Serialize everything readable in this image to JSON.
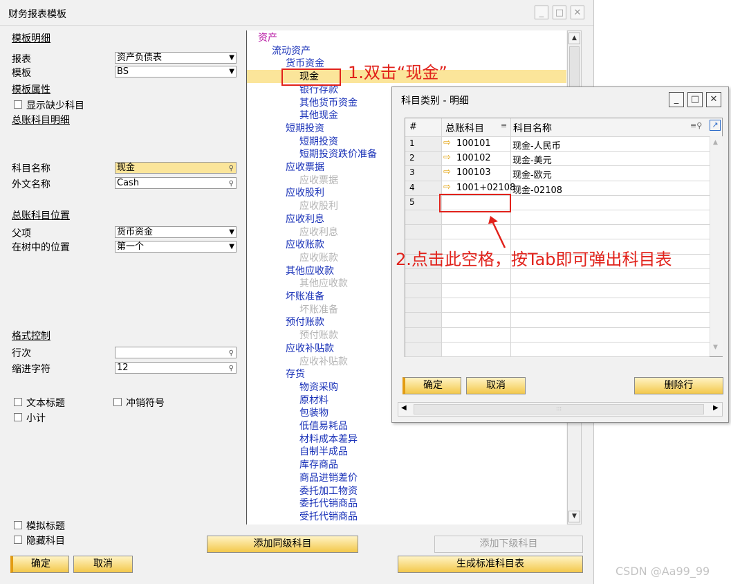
{
  "window": {
    "title": "财务报表模板",
    "controls": [
      "_",
      "□",
      "✕"
    ]
  },
  "left": {
    "template_detail": "模板明细",
    "report_label": "报表",
    "report_value": "资产负债表",
    "template_label": "模板",
    "template_value": "BS",
    "template_props": "模板属性",
    "show_missing": "显示缺少科目",
    "gl_detail": "总账科目明细",
    "acct_name_label": "科目名称",
    "acct_name_value": "现金",
    "foreign_name_label": "外文名称",
    "foreign_name_value": "Cash",
    "gl_position": "总账科目位置",
    "parent_label": "父项",
    "parent_value": "货币资金",
    "tree_pos_label": "在树中的位置",
    "tree_pos_value": "第一个",
    "format_ctrl": "格式控制",
    "row_label": "行次",
    "row_value": "",
    "indent_label": "缩进字符",
    "indent_value": "12",
    "text_title": "文本标题",
    "reversal": "冲销符号",
    "subtotal": "小计",
    "dummy_title": "模拟标题",
    "hide_acct": "隐藏科目"
  },
  "buttons": {
    "ok": "确定",
    "cancel": "取消",
    "add_same": "添加同级科目",
    "add_sub": "添加下级科目",
    "gen_std": "生成标准科目表"
  },
  "tree": {
    "nodes": [
      {
        "t": "资产",
        "lvl": 0,
        "s": "root"
      },
      {
        "t": "流动资产",
        "lvl": 1,
        "s": "n"
      },
      {
        "t": "货币资金",
        "lvl": 2,
        "s": "n"
      },
      {
        "t": "现金",
        "lvl": 3,
        "s": "sel"
      },
      {
        "t": "银行存款",
        "lvl": 3,
        "s": "n"
      },
      {
        "t": "其他货币资金",
        "lvl": 3,
        "s": "n"
      },
      {
        "t": "其他现金",
        "lvl": 3,
        "s": "n"
      },
      {
        "t": "短期投资",
        "lvl": 2,
        "s": "n"
      },
      {
        "t": "短期投资",
        "lvl": 3,
        "s": "n"
      },
      {
        "t": "短期投资跌价准备",
        "lvl": 3,
        "s": "n"
      },
      {
        "t": "应收票据",
        "lvl": 2,
        "s": "n"
      },
      {
        "t": "应收票据",
        "lvl": 3,
        "s": "grey"
      },
      {
        "t": "应收股利",
        "lvl": 2,
        "s": "n"
      },
      {
        "t": "应收股利",
        "lvl": 3,
        "s": "grey"
      },
      {
        "t": "应收利息",
        "lvl": 2,
        "s": "n"
      },
      {
        "t": "应收利息",
        "lvl": 3,
        "s": "grey"
      },
      {
        "t": "应收账款",
        "lvl": 2,
        "s": "n"
      },
      {
        "t": "应收账款",
        "lvl": 3,
        "s": "grey"
      },
      {
        "t": "其他应收款",
        "lvl": 2,
        "s": "n"
      },
      {
        "t": "其他应收款",
        "lvl": 3,
        "s": "grey"
      },
      {
        "t": "坏账准备",
        "lvl": 2,
        "s": "n"
      },
      {
        "t": "坏账准备",
        "lvl": 3,
        "s": "grey"
      },
      {
        "t": "预付账款",
        "lvl": 2,
        "s": "n"
      },
      {
        "t": "预付账款",
        "lvl": 3,
        "s": "grey"
      },
      {
        "t": "应收补贴款",
        "lvl": 2,
        "s": "n"
      },
      {
        "t": "应收补贴款",
        "lvl": 3,
        "s": "grey"
      },
      {
        "t": "存货",
        "lvl": 2,
        "s": "n"
      },
      {
        "t": "物资采购",
        "lvl": 3,
        "s": "n"
      },
      {
        "t": "原材料",
        "lvl": 3,
        "s": "n"
      },
      {
        "t": "包装物",
        "lvl": 3,
        "s": "n"
      },
      {
        "t": "低值易耗品",
        "lvl": 3,
        "s": "n"
      },
      {
        "t": "材料成本差异",
        "lvl": 3,
        "s": "n"
      },
      {
        "t": "自制半成品",
        "lvl": 3,
        "s": "n"
      },
      {
        "t": "库存商品",
        "lvl": 3,
        "s": "n"
      },
      {
        "t": "商品进销差价",
        "lvl": 3,
        "s": "n"
      },
      {
        "t": "委托加工物资",
        "lvl": 3,
        "s": "n"
      },
      {
        "t": "委托代销商品",
        "lvl": 3,
        "s": "n"
      },
      {
        "t": "受托代销商品",
        "lvl": 3,
        "s": "n"
      }
    ]
  },
  "popup": {
    "title": "科目类别 - 明细",
    "col_num": "#",
    "col_gl": "总账科目",
    "col_name": "科目名称",
    "rows": [
      {
        "n": "1",
        "gl": "100101",
        "name": "现金-人民币"
      },
      {
        "n": "2",
        "gl": "100102",
        "name": "现金-美元"
      },
      {
        "n": "3",
        "gl": "100103",
        "name": "现金-欧元"
      },
      {
        "n": "4",
        "gl": "1001+02108",
        "name": "现金-02108"
      },
      {
        "n": "5",
        "gl": "",
        "name": ""
      }
    ],
    "ok": "确定",
    "cancel": "取消",
    "delete_row": "删除行"
  },
  "annotations": {
    "step1": "1.双击“现金”",
    "step2": "2.点击此空格，按Tab即可弹出科目表",
    "color": "#e1221b"
  },
  "watermark": "CSDN @Aa99_99"
}
